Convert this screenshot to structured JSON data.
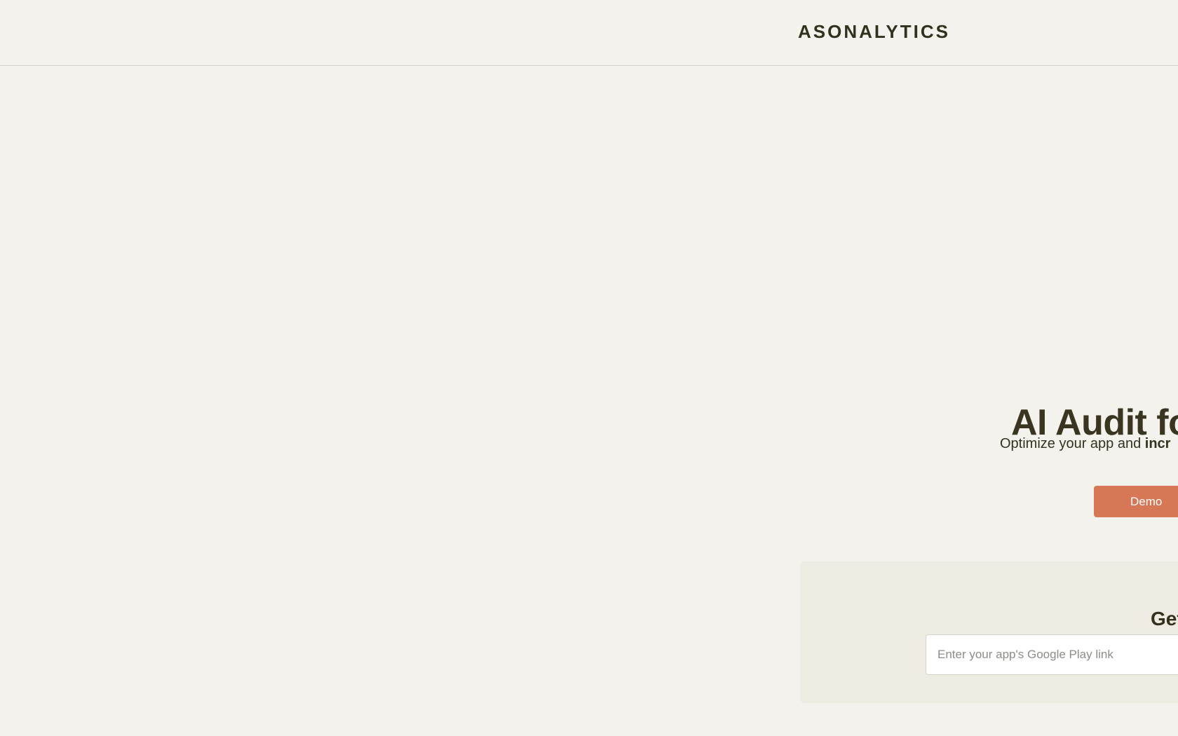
{
  "header": {
    "logo_text": "ASONALYTICS"
  },
  "hero": {
    "title": "AI Audit fo",
    "subtitle_prefix": "Optimize your app and ",
    "subtitle_bold": "incr",
    "demo_label": "Demo"
  },
  "audit_panel": {
    "title": "Get",
    "input_placeholder": "Enter your app's Google Play link",
    "input_value": ""
  },
  "colors": {
    "background": "#f4f2ec",
    "accent": "#d67755",
    "panel": "#edebe2",
    "text": "#35311f"
  }
}
